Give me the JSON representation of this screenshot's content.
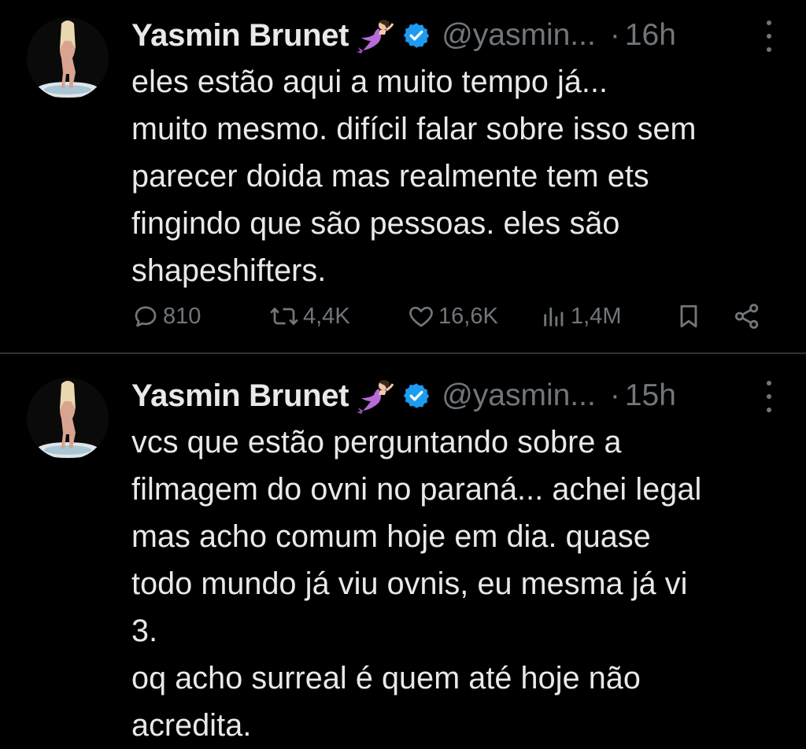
{
  "tweets": [
    {
      "author": {
        "name": "Yasmin Brunet",
        "handle": "@yasmin...",
        "badge_emoji_icon": "mermaid-icon",
        "verified_icon": "verified-badge-icon",
        "avatar": "avatar-photo"
      },
      "separator": "·",
      "time": "16h",
      "lines": [
        "eles estão aqui a muito tempo já...",
        "muito mesmo. difícil falar sobre isso sem",
        "parecer doida mas realmente tem ets",
        "fingindo que são pessoas. eles são",
        "shapeshifters."
      ],
      "actions": {
        "replies": "810",
        "reposts": "4,4K",
        "likes": "16,6K",
        "views": "1,4M"
      }
    },
    {
      "author": {
        "name": "Yasmin Brunet",
        "handle": "@yasmin...",
        "badge_emoji_icon": "mermaid-icon",
        "verified_icon": "verified-badge-icon",
        "avatar": "avatar-photo"
      },
      "separator": "·",
      "time": "15h",
      "lines": [
        "vcs que estão perguntando sobre a",
        "filmagem do ovni no paraná... achei legal",
        "mas acho comum hoje em dia. quase",
        "todo mundo já viu ovnis, eu mesma já vi",
        "3.",
        "oq acho surreal é quem até hoje não",
        "acredita."
      ]
    }
  ],
  "colors": {
    "background": "#000000",
    "text_primary": "#e7e9ea",
    "text_secondary": "#71767b",
    "divider": "#2f3336",
    "verified_blue": "#1d9bf0"
  }
}
